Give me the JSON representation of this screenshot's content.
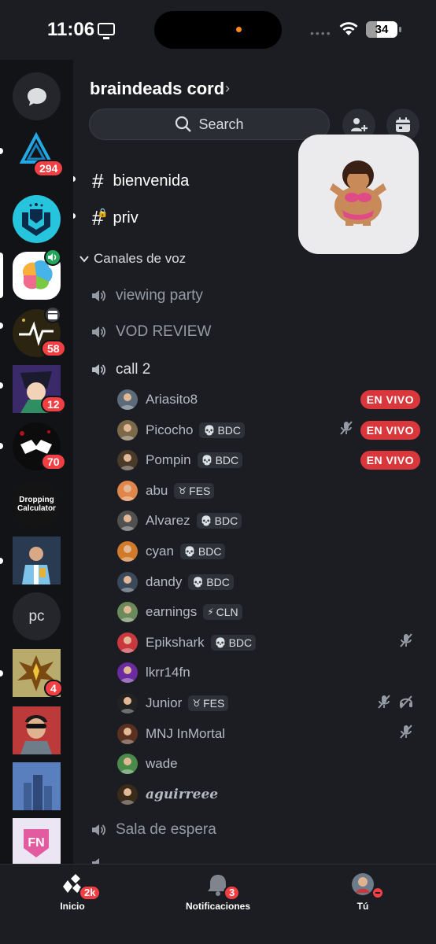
{
  "status_bar": {
    "time": "11:06",
    "battery": "34",
    "battery_level": 0.34
  },
  "server": {
    "name": "braindeads cord"
  },
  "search": {
    "label": "Search"
  },
  "rail": {
    "badges": [
      "294",
      "58",
      "12",
      "70",
      "4"
    ],
    "dropping_text": "Dropping\nCalculator",
    "pc_text": "pc"
  },
  "text_channels": [
    {
      "name": "bienvenida"
    },
    {
      "name": "priv"
    }
  ],
  "category": {
    "label": "Canales de voz"
  },
  "voice_channels": [
    {
      "name": "viewing party"
    },
    {
      "name": "VOD REVIEW"
    },
    {
      "name": "call 2"
    },
    {
      "name": "Sala de espera"
    }
  ],
  "voice_users": [
    {
      "name": "Ariasito8",
      "tag": "",
      "live": "EN VIVO",
      "muted": false,
      "deafened": false
    },
    {
      "name": "Picocho",
      "tag": "BDC",
      "tag_icon": "skull",
      "live": "EN VIVO",
      "muted": true,
      "deafened": false
    },
    {
      "name": "Pompin",
      "tag": "BDC",
      "tag_icon": "skull",
      "live": "EN VIVO",
      "muted": false,
      "deafened": false
    },
    {
      "name": "abu",
      "tag": "FES",
      "tag_icon": "goat",
      "live": "",
      "muted": false,
      "deafened": false
    },
    {
      "name": "Alvarez",
      "tag": "BDC",
      "tag_icon": "skull",
      "live": "",
      "muted": false,
      "deafened": false
    },
    {
      "name": "cyan",
      "tag": "BDC",
      "tag_icon": "skull",
      "live": "",
      "muted": false,
      "deafened": false
    },
    {
      "name": "dandy",
      "tag": "BDC",
      "tag_icon": "skull",
      "live": "",
      "muted": false,
      "deafened": false
    },
    {
      "name": "earnings",
      "tag": "CLN",
      "tag_icon": "bolt",
      "live": "",
      "muted": false,
      "deafened": false
    },
    {
      "name": "Epikshark",
      "tag": "BDC",
      "tag_icon": "skull",
      "live": "",
      "muted": true,
      "deafened": false
    },
    {
      "name": "lkrr14fn",
      "tag": "",
      "live": "",
      "muted": false,
      "deafened": false
    },
    {
      "name": "Junior",
      "tag": "FES",
      "tag_icon": "goat",
      "live": "",
      "muted": true,
      "deafened": true
    },
    {
      "name": "MNJ InMortal",
      "tag": "",
      "live": "",
      "muted": true,
      "deafened": false
    },
    {
      "name": "wade",
      "tag": "",
      "live": "",
      "muted": false,
      "deafened": false
    },
    {
      "name": "aguirreee",
      "tag": "",
      "live": "",
      "muted": false,
      "deafened": false
    }
  ],
  "nav": {
    "home": {
      "label": "Inicio",
      "badge": "2k"
    },
    "notifications": {
      "label": "Notificaciones",
      "badge": "3"
    },
    "you": {
      "label": "Tú"
    }
  },
  "colors": {
    "live_red": "#da373c",
    "badge_red": "#f23f43",
    "rail_bg": "#121317",
    "panel_bg": "#1c1d22"
  }
}
